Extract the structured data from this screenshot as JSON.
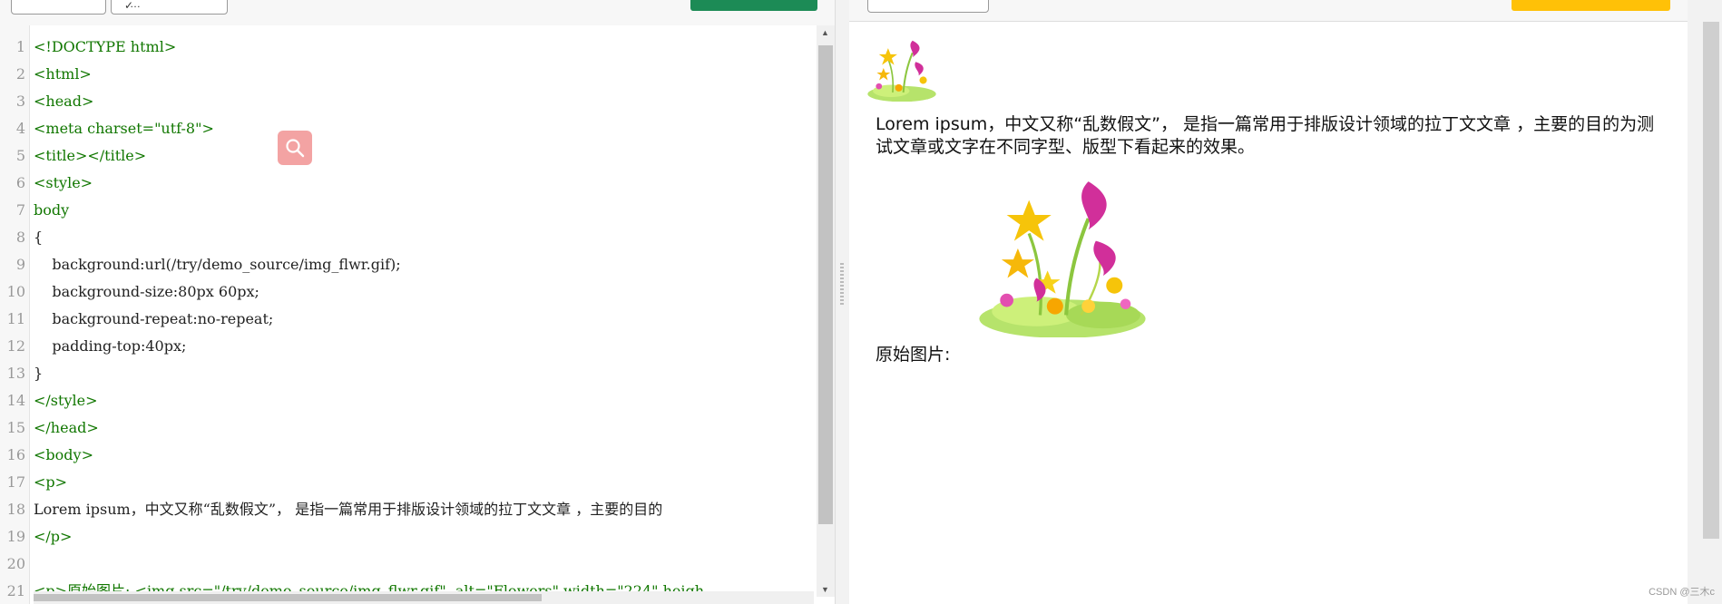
{
  "toolbar": {
    "btn1_label": "",
    "btn2_label": "…",
    "run_color": "#1c8b56",
    "result_color": "#ffc107"
  },
  "editor": {
    "lines": [
      {
        "n": "1",
        "t": "<!DOCTYPE html>"
      },
      {
        "n": "2",
        "t": "<html>"
      },
      {
        "n": "3",
        "t": "<head>"
      },
      {
        "n": "4",
        "t": "<meta charset=\"utf-8\">"
      },
      {
        "n": "5",
        "t": "<title></title>"
      },
      {
        "n": "6",
        "t": "<style>"
      },
      {
        "n": "7",
        "t": "body"
      },
      {
        "n": "8",
        "t": "{"
      },
      {
        "n": "9",
        "t": "    background:url(/try/demo_source/img_flwr.gif);"
      },
      {
        "n": "10",
        "t": "    background-size:80px 60px;"
      },
      {
        "n": "11",
        "t": "    background-repeat:no-repeat;"
      },
      {
        "n": "12",
        "t": "    padding-top:40px;"
      },
      {
        "n": "13",
        "t": "}"
      },
      {
        "n": "14",
        "t": "</style>"
      },
      {
        "n": "15",
        "t": "</head>"
      },
      {
        "n": "16",
        "t": "<body>"
      },
      {
        "n": "17",
        "t": "<p>"
      },
      {
        "n": "18",
        "t": "Lorem ipsum，中文又称“乱数假文”， 是指一篇常用于排版设计领域的拉丁文文章 ，主要的目的"
      },
      {
        "n": "19",
        "t": "</p>"
      },
      {
        "n": "20",
        "t": ""
      },
      {
        "n": "21",
        "t": "<p>原始图片: <img src=\"/try/demo_source/img_flwr.gif\"  alt=\"Flowers\" width=\"224\" heigh"
      }
    ]
  },
  "preview": {
    "paragraph": "Lorem ipsum，中文又称“乱数假文”， 是指一篇常用于排版设计领域的拉丁文文章 ，主要的目的为测试文章或文字在不同字型、版型下看起来的效果。",
    "original_label": "原始图片:",
    "image_alt": "Flowers"
  },
  "watermark": "CSDN @三木c"
}
